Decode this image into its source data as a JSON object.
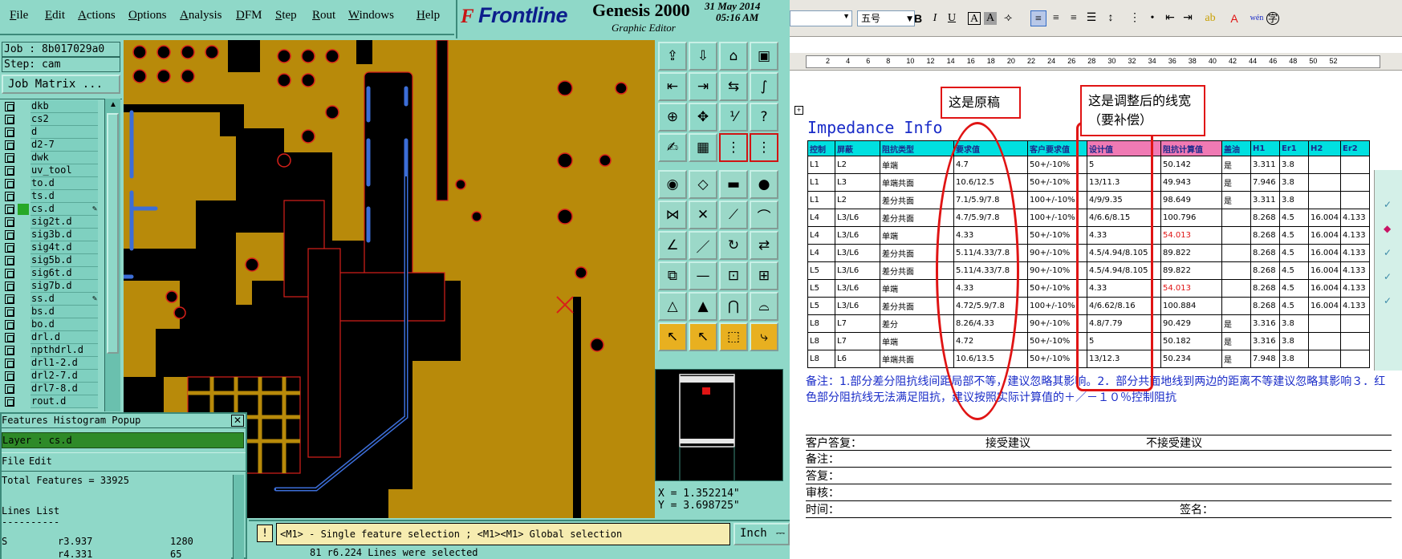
{
  "genesis": {
    "menu": [
      "File",
      "Edit",
      "Actions",
      "Options",
      "Analysis",
      "DFM",
      "Step",
      "Rout",
      "Windows",
      "Help"
    ],
    "logo_icon": "F",
    "logo_text": "Frontline",
    "product": "Genesis 2000",
    "product_sub": "Graphic Editor",
    "date": "31 May 2014",
    "time": "05:16 AM",
    "job_label": "Job : 8b017029a0",
    "step_label": "Step: cam",
    "job_matrix_button": "Job Matrix ...",
    "layers": [
      {
        "name": "dkb",
        "active": false,
        "mark": ""
      },
      {
        "name": "cs2",
        "active": false,
        "mark": ""
      },
      {
        "name": "d",
        "active": false,
        "mark": ""
      },
      {
        "name": "d2-7",
        "active": false,
        "mark": ""
      },
      {
        "name": "dwk",
        "active": false,
        "mark": ""
      },
      {
        "name": "uv_tool",
        "active": false,
        "mark": ""
      },
      {
        "name": "to.d",
        "active": false,
        "mark": ""
      },
      {
        "name": "ts.d",
        "active": false,
        "mark": ""
      },
      {
        "name": "cs.d",
        "active": true,
        "mark": "✎"
      },
      {
        "name": "sig2t.d",
        "active": false,
        "mark": ""
      },
      {
        "name": "sig3b.d",
        "active": false,
        "mark": ""
      },
      {
        "name": "sig4t.d",
        "active": false,
        "mark": ""
      },
      {
        "name": "sig5b.d",
        "active": false,
        "mark": ""
      },
      {
        "name": "sig6t.d",
        "active": false,
        "mark": ""
      },
      {
        "name": "sig7b.d",
        "active": false,
        "mark": ""
      },
      {
        "name": "ss.d",
        "active": false,
        "mark": "✎"
      },
      {
        "name": "bs.d",
        "active": false,
        "mark": ""
      },
      {
        "name": "bo.d",
        "active": false,
        "mark": ""
      },
      {
        "name": "drl.d",
        "active": false,
        "mark": ""
      },
      {
        "name": "npthdrl.d",
        "active": false,
        "mark": ""
      },
      {
        "name": "drl1-2.d",
        "active": false,
        "mark": ""
      },
      {
        "name": "drl2-7.d",
        "active": false,
        "mark": ""
      },
      {
        "name": "drl7-8.d",
        "active": false,
        "mark": ""
      },
      {
        "name": "rout.d",
        "active": false,
        "mark": ""
      }
    ],
    "popup": {
      "title": "Features Histogram Popup",
      "close": "✕",
      "layer": "Layer : cs.d",
      "menu": [
        "File",
        "Edit"
      ],
      "total": "Total Features = 33925",
      "lines_list": "Lines List",
      "separator": "----------",
      "row1_symbol": "r3.937",
      "row1_count": "1280",
      "row1_prefix": "S",
      "row2_symbol": "r4.331",
      "row2_count": "65"
    },
    "coords": {
      "x": "X = 1.352214\"",
      "y": "Y = 3.698725\""
    },
    "status_icon": "!",
    "status_message": "<M1> - Single feature selection ; <M1><M1> Global selection",
    "units": "Inch",
    "bottom_message": "81 r6.224 Lines were selected",
    "colors": {
      "panel": "#8fd8c8",
      "copper": "#b88a0a",
      "trace": "#3c6ed8",
      "outline": "#d8201a"
    }
  },
  "word": {
    "toolbar": {
      "font_size": "五号",
      "bold": "B",
      "italic": "I",
      "underline": "U",
      "char_border": "A",
      "char_shade": "A",
      "font_color": "A",
      "phonetic": "wén",
      "encircle": "字"
    },
    "ruler": [
      "2",
      "4",
      "6",
      "8",
      "10",
      "12",
      "14",
      "16",
      "18",
      "20",
      "22",
      "24",
      "26",
      "28",
      "30",
      "32",
      "34",
      "36",
      "38",
      "40",
      "42",
      "44",
      "46",
      "48",
      "50",
      "52"
    ],
    "title": "Impedance Info",
    "table": {
      "headers": [
        "控制",
        "屏蔽",
        "阻抗类型",
        "要求值",
        "客户要求值",
        "设计值",
        "阻抗计算值",
        "盖油",
        "H1",
        "Er1",
        "H2",
        "Er2"
      ],
      "rows": [
        [
          "L1",
          "L2",
          "单端",
          "4.7",
          "50+/-10%",
          "5",
          "50.142",
          "是",
          "3.311",
          "3.8",
          "",
          ""
        ],
        [
          "L1",
          "L3",
          "单端共面",
          "10.6/12.5",
          "50+/-10%",
          "13/11.3",
          "49.943",
          "是",
          "7.946",
          "3.8",
          "",
          ""
        ],
        [
          "L1",
          "L2",
          "差分共面",
          "7.1/5.9/7.8",
          "100+/-10%",
          "4/9/9.35",
          "98.649",
          "是",
          "3.311",
          "3.8",
          "",
          ""
        ],
        [
          "L4",
          "L3/L6",
          "差分共面",
          "4.7/5.9/7.8",
          "100+/-10%",
          "4/6.6/8.15",
          "100.796",
          "",
          "8.268",
          "4.5",
          "16.004",
          "4.133"
        ],
        [
          "L4",
          "L3/L6",
          "单端",
          "4.33",
          "50+/-10%",
          "4.33",
          "54.013",
          "",
          "8.268",
          "4.5",
          "16.004",
          "4.133"
        ],
        [
          "L4",
          "L3/L6",
          "差分共面",
          "5.11/4.33/7.8",
          "90+/-10%",
          "4.5/4.94/8.105",
          "89.822",
          "",
          "8.268",
          "4.5",
          "16.004",
          "4.133"
        ],
        [
          "L5",
          "L3/L6",
          "差分共面",
          "5.11/4.33/7.8",
          "90+/-10%",
          "4.5/4.94/8.105",
          "89.822",
          "",
          "8.268",
          "4.5",
          "16.004",
          "4.133"
        ],
        [
          "L5",
          "L3/L6",
          "单端",
          "4.33",
          "50+/-10%",
          "4.33",
          "54.013",
          "",
          "8.268",
          "4.5",
          "16.004",
          "4.133"
        ],
        [
          "L5",
          "L3/L6",
          "差分共面",
          "4.72/5.9/7.8",
          "100+/-10%",
          "4/6.62/8.16",
          "100.884",
          "",
          "8.268",
          "4.5",
          "16.004",
          "4.133"
        ],
        [
          "L8",
          "L7",
          "差分",
          "8.26/4.33",
          "90+/-10%",
          "4.8/7.79",
          "90.429",
          "是",
          "3.316",
          "3.8",
          "",
          ""
        ],
        [
          "L8",
          "L7",
          "单端",
          "4.72",
          "50+/-10%",
          "5",
          "50.182",
          "是",
          "3.316",
          "3.8",
          "",
          ""
        ],
        [
          "L8",
          "L6",
          "单端共面",
          "10.6/13.5",
          "50+/-10%",
          "13/12.3",
          "50.234",
          "是",
          "7.948",
          "3.8",
          "",
          ""
        ]
      ]
    },
    "notes": "备注：1.部分差分阻抗线间距局部不等，建议忽略其影响。2．部分共面地线到两边的距离不等建议忽略其影响３．红色部分阻抗线无法满足阻抗，建议按照实际计算值的＋／－１０％控制阻抗",
    "form": {
      "customer_reply": "客户答复：",
      "accept": "接受建议",
      "reject": "不接受建议",
      "remark": "备注：",
      "answer": "答复：",
      "review": "审核：",
      "time": "时间：",
      "sign": "签名："
    },
    "callouts": {
      "original": "这是原稿",
      "adjusted": "这是调整后的线宽（要补偿）"
    }
  }
}
